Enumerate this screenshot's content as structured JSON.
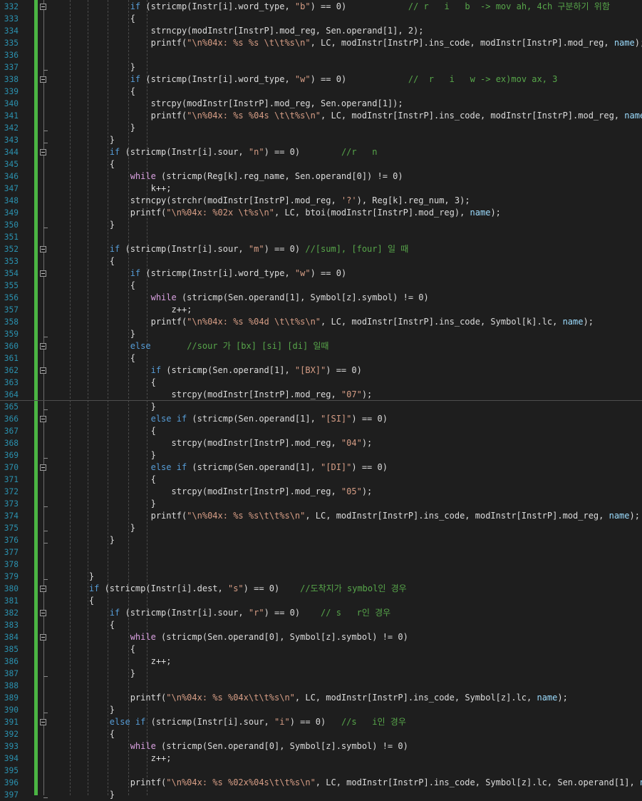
{
  "editor": {
    "lines": [
      {
        "num": "332",
        "indent": "            ",
        "fold": true,
        "toks": [
          [
            "if",
            "k"
          ],
          [
            " (stricmp(Instr[i].word_type, ",
            ""
          ],
          [
            "\"b\"",
            "s"
          ],
          [
            ") == 0)            ",
            ""
          ],
          [
            "// r   i   b  -> mov ah, 4ch 구분하기 위함",
            "c"
          ]
        ]
      },
      {
        "num": "333",
        "indent": "            ",
        "fold": false,
        "toks": [
          [
            "{",
            ""
          ]
        ]
      },
      {
        "num": "334",
        "indent": "                ",
        "fold": false,
        "toks": [
          [
            "strncpy(modInstr[InstrP].mod_reg, Sen.operand[1], 2);",
            ""
          ]
        ]
      },
      {
        "num": "335",
        "indent": "                ",
        "fold": false,
        "toks": [
          [
            "printf(",
            ""
          ],
          [
            "\"\\n%04x: %s %s \\t\\t%s\\n\"",
            "s"
          ],
          [
            ", LC, modInstr[InstrP].ins_code, modInstr[InstrP].mod_reg, ",
            ""
          ],
          [
            "name",
            "v"
          ],
          [
            ");",
            ""
          ]
        ]
      },
      {
        "num": "336",
        "indent": "",
        "fold": false,
        "toks": []
      },
      {
        "num": "337",
        "indent": "            ",
        "fold": false,
        "toks": [
          [
            "}",
            ""
          ]
        ]
      },
      {
        "num": "338",
        "indent": "            ",
        "fold": true,
        "toks": [
          [
            "if",
            "k"
          ],
          [
            " (stricmp(Instr[i].word_type, ",
            ""
          ],
          [
            "\"w\"",
            "s"
          ],
          [
            ") == 0)            ",
            ""
          ],
          [
            "//  r   i   w -> ex)mov ax, 3",
            "c"
          ]
        ]
      },
      {
        "num": "339",
        "indent": "            ",
        "fold": false,
        "toks": [
          [
            "{",
            ""
          ]
        ]
      },
      {
        "num": "340",
        "indent": "                ",
        "fold": false,
        "toks": [
          [
            "strcpy(modInstr[InstrP].mod_reg, Sen.operand[1]);",
            ""
          ]
        ]
      },
      {
        "num": "341",
        "indent": "                ",
        "fold": false,
        "toks": [
          [
            "printf(",
            ""
          ],
          [
            "\"\\n%04x: %s %04s \\t\\t%s\\n\"",
            "s"
          ],
          [
            ", LC, modInstr[InstrP].ins_code, modInstr[InstrP].mod_reg, ",
            ""
          ],
          [
            "name",
            "v"
          ],
          [
            ");",
            ""
          ]
        ]
      },
      {
        "num": "342",
        "indent": "            ",
        "fold": false,
        "toks": [
          [
            "}",
            ""
          ]
        ]
      },
      {
        "num": "343",
        "indent": "        ",
        "fold": false,
        "toks": [
          [
            "}",
            ""
          ]
        ]
      },
      {
        "num": "344",
        "indent": "        ",
        "fold": true,
        "toks": [
          [
            "if",
            "k"
          ],
          [
            " (stricmp(Instr[i].sour, ",
            ""
          ],
          [
            "\"n\"",
            "s"
          ],
          [
            ") == 0)        ",
            ""
          ],
          [
            "//r   n",
            "c"
          ]
        ]
      },
      {
        "num": "345",
        "indent": "        ",
        "fold": false,
        "toks": [
          [
            "{",
            ""
          ]
        ]
      },
      {
        "num": "346",
        "indent": "            ",
        "fold": false,
        "toks": [
          [
            "while",
            "k2"
          ],
          [
            " (stricmp(Reg[k].reg_name, Sen.operand[0]) != 0)",
            ""
          ]
        ]
      },
      {
        "num": "347",
        "indent": "                ",
        "fold": false,
        "toks": [
          [
            "k++;",
            ""
          ]
        ]
      },
      {
        "num": "348",
        "indent": "            ",
        "fold": false,
        "toks": [
          [
            "strncpy(strchr(modInstr[InstrP].mod_reg, ",
            ""
          ],
          [
            "'?'",
            "s"
          ],
          [
            "), Reg[k].reg_num, 3);",
            ""
          ]
        ]
      },
      {
        "num": "349",
        "indent": "            ",
        "fold": false,
        "toks": [
          [
            "printf(",
            ""
          ],
          [
            "\"\\n%04x: %02x \\t%s\\n\"",
            "s"
          ],
          [
            ", LC, btoi(modInstr[InstrP].mod_reg), ",
            ""
          ],
          [
            "name",
            "v"
          ],
          [
            ");",
            ""
          ]
        ]
      },
      {
        "num": "350",
        "indent": "        ",
        "fold": false,
        "toks": [
          [
            "}",
            ""
          ]
        ]
      },
      {
        "num": "351",
        "indent": "",
        "fold": false,
        "toks": []
      },
      {
        "num": "352",
        "indent": "        ",
        "fold": true,
        "toks": [
          [
            "if",
            "k"
          ],
          [
            " (stricmp(Instr[i].sour, ",
            ""
          ],
          [
            "\"m\"",
            "s"
          ],
          [
            ") == 0) ",
            ""
          ],
          [
            "//[sum], [four] 일 때",
            "c"
          ]
        ]
      },
      {
        "num": "353",
        "indent": "        ",
        "fold": false,
        "toks": [
          [
            "{",
            ""
          ]
        ]
      },
      {
        "num": "354",
        "indent": "            ",
        "fold": true,
        "toks": [
          [
            "if",
            "k"
          ],
          [
            " (stricmp(Instr[i].word_type, ",
            ""
          ],
          [
            "\"w\"",
            "s"
          ],
          [
            ") == 0)",
            ""
          ]
        ]
      },
      {
        "num": "355",
        "indent": "            ",
        "fold": false,
        "toks": [
          [
            "{",
            ""
          ]
        ]
      },
      {
        "num": "356",
        "indent": "                ",
        "fold": false,
        "toks": [
          [
            "while",
            "k2"
          ],
          [
            " (stricmp(Sen.operand[1], Symbol[z].symbol) != 0)",
            ""
          ]
        ]
      },
      {
        "num": "357",
        "indent": "                    ",
        "fold": false,
        "toks": [
          [
            "z++;",
            ""
          ]
        ]
      },
      {
        "num": "358",
        "indent": "                ",
        "fold": false,
        "toks": [
          [
            "printf(",
            ""
          ],
          [
            "\"\\n%04x: %s %04d \\t\\t%s\\n\"",
            "s"
          ],
          [
            ", LC, modInstr[InstrP].ins_code, Symbol[k].lc, ",
            ""
          ],
          [
            "name",
            "v"
          ],
          [
            ");",
            ""
          ]
        ]
      },
      {
        "num": "359",
        "indent": "            ",
        "fold": false,
        "toks": [
          [
            "}",
            ""
          ]
        ]
      },
      {
        "num": "360",
        "indent": "            ",
        "fold": true,
        "toks": [
          [
            "else",
            "k"
          ],
          [
            "       ",
            ""
          ],
          [
            "//sour 가 [bx] [si] [di] 일때",
            "c"
          ]
        ]
      },
      {
        "num": "361",
        "indent": "            ",
        "fold": false,
        "toks": [
          [
            "{",
            ""
          ]
        ]
      },
      {
        "num": "362",
        "indent": "                ",
        "fold": true,
        "toks": [
          [
            "if",
            "k"
          ],
          [
            " (stricmp(Sen.operand[1], ",
            ""
          ],
          [
            "\"[BX]\"",
            "s"
          ],
          [
            ") == 0)",
            ""
          ]
        ]
      },
      {
        "num": "363",
        "indent": "                ",
        "fold": false,
        "toks": [
          [
            "{",
            ""
          ]
        ]
      },
      {
        "num": "364",
        "indent": "                    ",
        "fold": false,
        "toks": [
          [
            "strcpy(modInstr[InstrP].mod_reg, ",
            ""
          ],
          [
            "\"07\"",
            "s"
          ],
          [
            ");",
            ""
          ]
        ]
      },
      {
        "num": "365",
        "indent": "                ",
        "fold": false,
        "toks": [
          [
            "}",
            ""
          ]
        ]
      },
      {
        "num": "366",
        "indent": "                ",
        "fold": true,
        "toks": [
          [
            "else if",
            "k"
          ],
          [
            " (stricmp(Sen.operand[1], ",
            ""
          ],
          [
            "\"[SI]\"",
            "s"
          ],
          [
            ") == 0)",
            ""
          ]
        ]
      },
      {
        "num": "367",
        "indent": "                ",
        "fold": false,
        "toks": [
          [
            "{",
            ""
          ]
        ]
      },
      {
        "num": "368",
        "indent": "                    ",
        "fold": false,
        "toks": [
          [
            "strcpy(modInstr[InstrP].mod_reg, ",
            ""
          ],
          [
            "\"04\"",
            "s"
          ],
          [
            ");",
            ""
          ]
        ]
      },
      {
        "num": "369",
        "indent": "                ",
        "fold": false,
        "toks": [
          [
            "}",
            ""
          ]
        ]
      },
      {
        "num": "370",
        "indent": "                ",
        "fold": true,
        "toks": [
          [
            "else if",
            "k"
          ],
          [
            " (stricmp(Sen.operand[1], ",
            ""
          ],
          [
            "\"[DI]\"",
            "s"
          ],
          [
            ") == 0)",
            ""
          ]
        ]
      },
      {
        "num": "371",
        "indent": "                ",
        "fold": false,
        "toks": [
          [
            "{",
            ""
          ]
        ]
      },
      {
        "num": "372",
        "indent": "                    ",
        "fold": false,
        "toks": [
          [
            "strcpy(modInstr[InstrP].mod_reg, ",
            ""
          ],
          [
            "\"05\"",
            "s"
          ],
          [
            ");",
            ""
          ]
        ]
      },
      {
        "num": "373",
        "indent": "                ",
        "fold": false,
        "toks": [
          [
            "}",
            ""
          ]
        ]
      },
      {
        "num": "374",
        "indent": "                ",
        "fold": false,
        "toks": [
          [
            "printf(",
            ""
          ],
          [
            "\"\\n%04x: %s %s\\t\\t%s\\n\"",
            "s"
          ],
          [
            ", LC, modInstr[InstrP].ins_code, modInstr[InstrP].mod_reg, ",
            ""
          ],
          [
            "name",
            "v"
          ],
          [
            ");",
            ""
          ]
        ]
      },
      {
        "num": "375",
        "indent": "            ",
        "fold": false,
        "toks": [
          [
            "}",
            ""
          ]
        ]
      },
      {
        "num": "376",
        "indent": "        ",
        "fold": false,
        "toks": [
          [
            "}",
            ""
          ]
        ]
      },
      {
        "num": "377",
        "indent": "",
        "fold": false,
        "toks": []
      },
      {
        "num": "378",
        "indent": "",
        "fold": false,
        "toks": []
      },
      {
        "num": "379",
        "indent": "    ",
        "fold": false,
        "toks": [
          [
            "}",
            ""
          ]
        ]
      },
      {
        "num": "380",
        "indent": "    ",
        "fold": true,
        "toks": [
          [
            "if",
            "k"
          ],
          [
            " (stricmp(Instr[i].dest, ",
            ""
          ],
          [
            "\"s\"",
            "s"
          ],
          [
            ") == 0)    ",
            ""
          ],
          [
            "//도착지가 symbol인 경우",
            "c"
          ]
        ]
      },
      {
        "num": "381",
        "indent": "    ",
        "fold": false,
        "toks": [
          [
            "{",
            ""
          ]
        ]
      },
      {
        "num": "382",
        "indent": "        ",
        "fold": true,
        "toks": [
          [
            "if",
            "k"
          ],
          [
            " (stricmp(Instr[i].sour, ",
            ""
          ],
          [
            "\"r\"",
            "s"
          ],
          [
            ") == 0)    ",
            ""
          ],
          [
            "// s   r인 경우",
            "c"
          ]
        ]
      },
      {
        "num": "383",
        "indent": "        ",
        "fold": false,
        "toks": [
          [
            "{",
            ""
          ]
        ]
      },
      {
        "num": "384",
        "indent": "            ",
        "fold": true,
        "toks": [
          [
            "while",
            "k2"
          ],
          [
            " (stricmp(Sen.operand[0], Symbol[z].symbol) != 0)",
            ""
          ]
        ]
      },
      {
        "num": "385",
        "indent": "            ",
        "fold": false,
        "toks": [
          [
            "{",
            ""
          ]
        ]
      },
      {
        "num": "386",
        "indent": "                ",
        "fold": false,
        "toks": [
          [
            "z++;",
            ""
          ]
        ]
      },
      {
        "num": "387",
        "indent": "            ",
        "fold": false,
        "toks": [
          [
            "}",
            ""
          ]
        ]
      },
      {
        "num": "388",
        "indent": "",
        "fold": false,
        "toks": []
      },
      {
        "num": "389",
        "indent": "            ",
        "fold": false,
        "toks": [
          [
            "printf(",
            ""
          ],
          [
            "\"\\n%04x: %s %04x\\t\\t%s\\n\"",
            "s"
          ],
          [
            ", LC, modInstr[InstrP].ins_code, Symbol[z].lc, ",
            ""
          ],
          [
            "name",
            "v"
          ],
          [
            ");",
            ""
          ]
        ]
      },
      {
        "num": "390",
        "indent": "        ",
        "fold": false,
        "toks": [
          [
            "}",
            ""
          ]
        ]
      },
      {
        "num": "391",
        "indent": "        ",
        "fold": true,
        "toks": [
          [
            "else if",
            "k"
          ],
          [
            " (stricmp(Instr[i].sour, ",
            ""
          ],
          [
            "\"i\"",
            "s"
          ],
          [
            ") == 0)   ",
            ""
          ],
          [
            "//s   i인 경우",
            "c"
          ]
        ]
      },
      {
        "num": "392",
        "indent": "        ",
        "fold": false,
        "toks": [
          [
            "{",
            ""
          ]
        ]
      },
      {
        "num": "393",
        "indent": "            ",
        "fold": false,
        "toks": [
          [
            "while",
            "k2"
          ],
          [
            " (stricmp(Sen.operand[0], Symbol[z].symbol) != 0)",
            ""
          ]
        ]
      },
      {
        "num": "394",
        "indent": "                ",
        "fold": false,
        "toks": [
          [
            "z++;",
            ""
          ]
        ]
      },
      {
        "num": "395",
        "indent": "",
        "fold": false,
        "toks": []
      },
      {
        "num": "396",
        "indent": "            ",
        "fold": false,
        "toks": [
          [
            "printf(",
            ""
          ],
          [
            "\"\\n%04x: %s %02x%04s\\t\\t%s\\n\"",
            "s"
          ],
          [
            ", LC, modInstr[InstrP].ins_code, Symbol[z].lc, Sen.operand[1], ",
            ""
          ],
          [
            "name",
            "v"
          ],
          [
            ");",
            ""
          ]
        ]
      },
      {
        "num": "397",
        "indent": "        ",
        "fold": false,
        "toks": [
          [
            "}",
            ""
          ]
        ]
      }
    ]
  }
}
